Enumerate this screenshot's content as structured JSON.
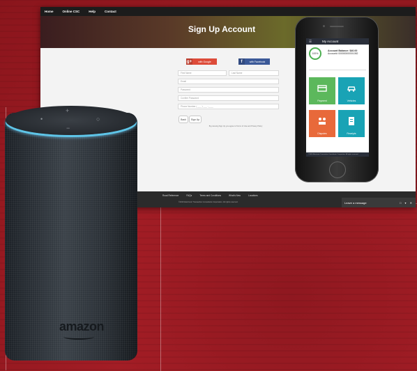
{
  "desktop": {
    "nav": [
      "Home",
      "Online CSC",
      "Help",
      "Contact"
    ],
    "hero_title": "Sign Up Account",
    "social": {
      "google": "with Google",
      "facebook": "with Facebook",
      "google_icon": "g+",
      "facebook_icon": "f"
    },
    "fields": {
      "first_name": "First Name",
      "last_name": "Last Name",
      "email": "Email",
      "password": "Password",
      "confirm_password": "Confirm Password",
      "phone": "Phone Number ( ___ ) ___ -____"
    },
    "buttons": {
      "back": "Back",
      "signup": "Sign Up"
    },
    "terms": "By pressing Sign Up you agree to Terms of Use and Privacy Policy",
    "footer": {
      "links": [
        "Road Reference",
        "FAQs",
        "Terms and Conditions",
        "What's New",
        "Locations"
      ],
      "copyright": "©2016 Electronic Transaction Consultants Corporation. All rights reserved."
    },
    "leave_message": "Leave a message",
    "leave_controls": "□ ▾ ✕"
  },
  "phone": {
    "app_title": "My Account",
    "balance_pct": "100%",
    "balance_label": "Account Balance: $40.00",
    "account_number": "Account# 000000000001082",
    "tiles": [
      "Payment",
      "Vehicles",
      "Disputes",
      "Receipts"
    ],
    "footer": "©2016 Electronic Transaction Consultants Corporation. All rights reserved."
  },
  "product": {
    "brand": "amazon"
  },
  "colors": {
    "background": "#9e1b22",
    "google": "#dd4b39",
    "facebook": "#3b5998",
    "green": "#5cb85c",
    "teal": "#19a3b5",
    "orange": "#e8693a"
  }
}
